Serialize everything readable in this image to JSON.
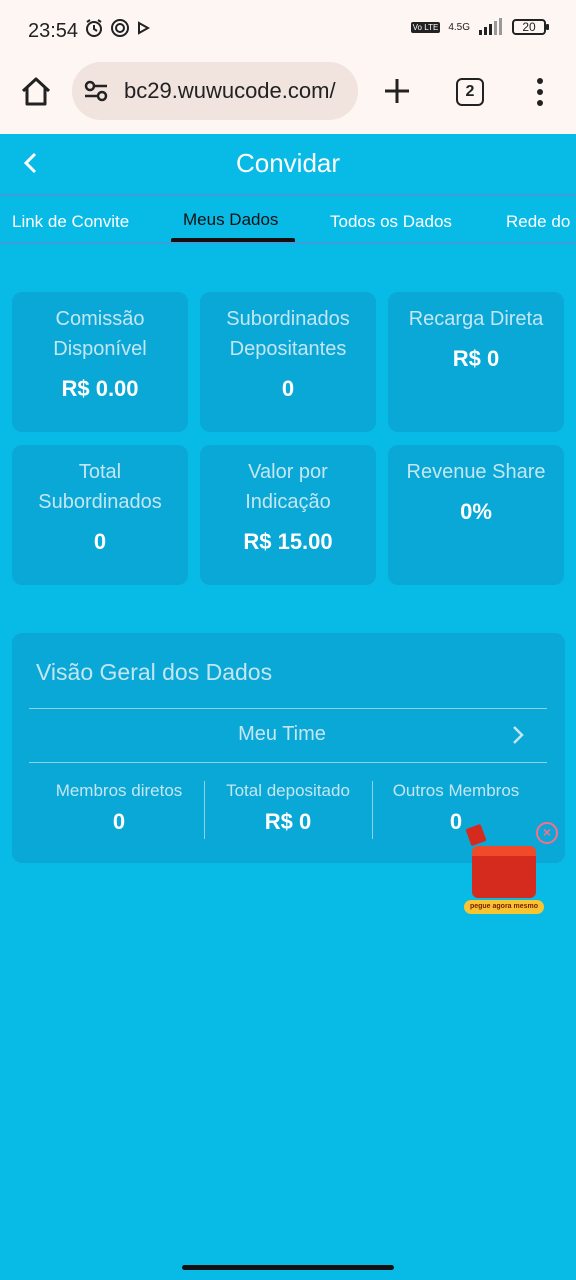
{
  "status_bar": {
    "time": "23:54",
    "network": "4.5G",
    "volte": "Vo LTE",
    "battery": "20"
  },
  "browser": {
    "url": "bc29.wuwucode.com/",
    "tab_count": "2"
  },
  "header": {
    "title": "Convidar"
  },
  "tabs": [
    {
      "label": "Link de Convite"
    },
    {
      "label": "Meus Dados"
    },
    {
      "label": "Todos os Dados"
    },
    {
      "label": "Rede do"
    }
  ],
  "cards": [
    {
      "label": "Comissão Disponível",
      "value": "R$ 0.00"
    },
    {
      "label": "Subordinados Depositantes",
      "value": "0"
    },
    {
      "label": "Recarga Direta",
      "value": "R$ 0"
    },
    {
      "label": "Total Subordinados",
      "value": "0"
    },
    {
      "label": "Valor por Indicação",
      "value": "R$ 15.00"
    },
    {
      "label": "Revenue Share",
      "value": "0%"
    }
  ],
  "overview": {
    "title": "Visão Geral dos Dados",
    "team_label": "Meu Time",
    "stats": [
      {
        "label": "Membros diretos",
        "value": "0"
      },
      {
        "label": "Total depositado",
        "value": "R$ 0"
      },
      {
        "label": "Outros Membros",
        "value": "0"
      }
    ]
  },
  "promo": {
    "tag": "pegue agora mesmo",
    "close": "×"
  },
  "colors": {
    "background": "#08bbe7",
    "card": "#0aa8d6",
    "label": "#c4e6f2",
    "value": "#ffffff"
  }
}
